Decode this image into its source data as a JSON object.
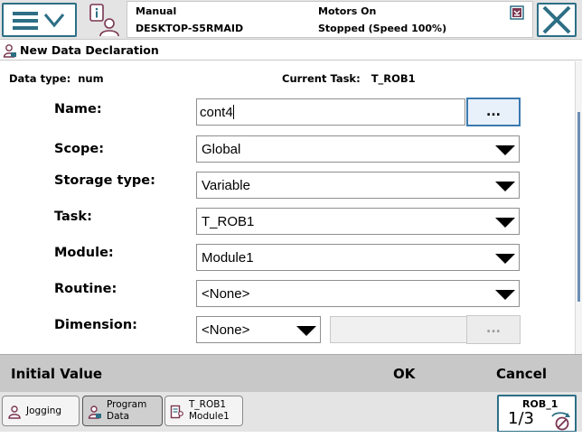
{
  "topbar": {
    "status": {
      "mode": "Manual",
      "controller": "DESKTOP-S5RMAID",
      "motors": "Motors On",
      "state": "Stopped (Speed 100%)"
    }
  },
  "title": "New Data Declaration",
  "info": {
    "data_type_label": "Data type:",
    "data_type_value": "num",
    "task_label": "Current Task:",
    "task_value": "T_ROB1"
  },
  "form": {
    "name": {
      "label": "Name:",
      "value": "cont4",
      "button": "..."
    },
    "scope": {
      "label": "Scope:",
      "value": "Global"
    },
    "storage": {
      "label": "Storage type:",
      "value": "Variable"
    },
    "task": {
      "label": "Task:",
      "value": "T_ROB1"
    },
    "module": {
      "label": "Module:",
      "value": "Module1"
    },
    "routine": {
      "label": "Routine:",
      "value": "<None>"
    },
    "dimension": {
      "label": "Dimension:",
      "value": "<None>",
      "button": "..."
    }
  },
  "commands": {
    "initial_value": "Initial Value",
    "ok": "OK",
    "cancel": "Cancel"
  },
  "taskbar": {
    "items": [
      {
        "line1": "Jogging",
        "line2": ""
      },
      {
        "line1": "Program",
        "line2": "Data"
      },
      {
        "line1": "T_ROB1",
        "line2": "Module1"
      }
    ],
    "robot": {
      "label": "ROB_1",
      "fraction": "1/3"
    }
  },
  "colors": {
    "accent_border": "#2d6f85",
    "command_bar": "#c8c8c8",
    "top_bar": "#e4e4e4"
  }
}
